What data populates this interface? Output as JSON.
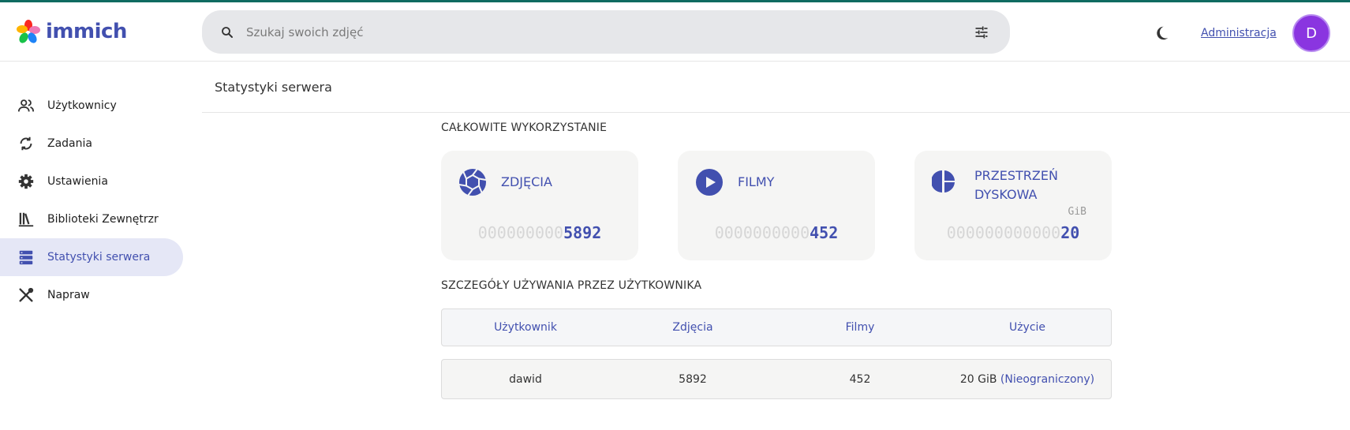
{
  "app": {
    "name": "immich"
  },
  "search": {
    "placeholder": "Szukaj swoich zdjęć"
  },
  "header": {
    "admin_link": "Administracja",
    "avatar_initial": "D"
  },
  "sidebar": {
    "items": [
      {
        "label": "Użytkownicy",
        "icon": "users-icon"
      },
      {
        "label": "Zadania",
        "icon": "sync-icon"
      },
      {
        "label": "Ustawienia",
        "icon": "gear-icon"
      },
      {
        "label": "Biblioteki Zewnętrzr",
        "icon": "library-icon"
      },
      {
        "label": "Statystyki serwera",
        "icon": "server-icon",
        "active": true
      },
      {
        "label": "Napraw",
        "icon": "tools-icon"
      }
    ]
  },
  "page": {
    "title": "Statystyki serwera",
    "total_usage_title": "CAŁKOWITE WYKORZYSTANIE",
    "user_usage_title": "SZCZEGÓŁY UŻYWANIA PRZEZ UŻYTKOWNIKA"
  },
  "cards": [
    {
      "label": "ZDJĘCIA",
      "zeros": "000000000",
      "value": "5892",
      "unit": "",
      "icon": "aperture-icon"
    },
    {
      "label": "FILMY",
      "zeros": "0000000000",
      "value": "452",
      "unit": "",
      "icon": "play-icon"
    },
    {
      "label_line1": "PRZESTRZEŃ",
      "label_line2": "DYSKOWA",
      "zeros": "000000000000",
      "value": "20",
      "unit": "GiB",
      "icon": "pie-chart-icon"
    }
  ],
  "table": {
    "headers": [
      "Użytkownik",
      "Zdjęcia",
      "Filmy",
      "Użycie"
    ],
    "rows": [
      {
        "user": "dawid",
        "photos": "5892",
        "videos": "452",
        "usage": "20 GiB",
        "quota": "(Nieograniczony)"
      }
    ]
  },
  "colors": {
    "accent": "#4250af",
    "topline": "#0f6b61",
    "avatar": "#8a35e0"
  }
}
